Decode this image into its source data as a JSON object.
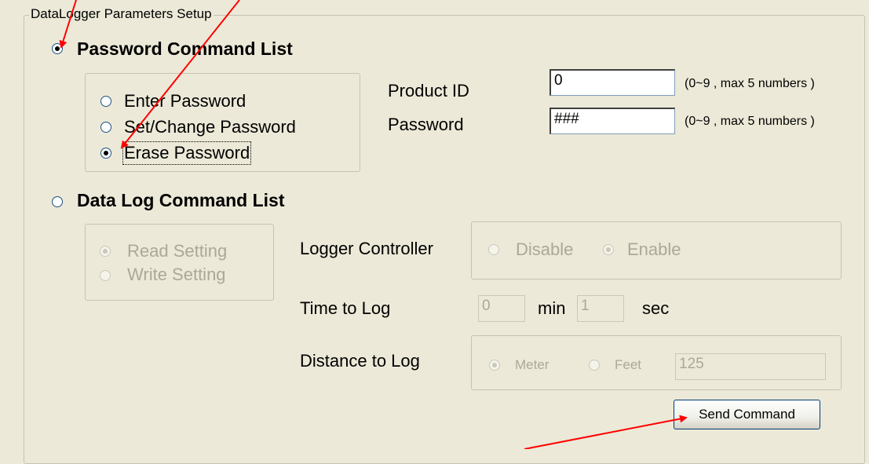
{
  "setup": {
    "title": "DataLogger Parameters Setup"
  },
  "password_section": {
    "heading": "Password Command List",
    "selected": true,
    "options": [
      {
        "label": "Enter Password",
        "checked": false
      },
      {
        "label": "Set/Change Password",
        "checked": false
      },
      {
        "label": "Erase Password",
        "checked": true
      }
    ],
    "product_id": {
      "label": "Product ID",
      "value": "0",
      "hint": "(0~9 , max 5 numbers )"
    },
    "password": {
      "label": "Password",
      "value": "###",
      "hint": "(0~9 , max 5 numbers )"
    }
  },
  "datalog_section": {
    "heading": "Data Log Command List",
    "selected": false,
    "options": [
      {
        "label": "Read Setting",
        "checked": true,
        "disabled": true
      },
      {
        "label": "Write Setting",
        "checked": false,
        "disabled": true
      }
    ],
    "logger_controller": {
      "label": "Logger Controller",
      "disable_label": "Disable",
      "enable_label": "Enable",
      "selected": "Enable"
    },
    "time_to_log": {
      "label": "Time to Log",
      "min_value": "0",
      "min_unit": "min",
      "sec_value": "1",
      "sec_unit": "sec"
    },
    "distance_to_log": {
      "label": "Distance to Log",
      "meter_label": "Meter",
      "feet_label": "Feet",
      "selected": "Meter",
      "value": "125"
    }
  },
  "send_button": {
    "label": "Send Command"
  },
  "colors": {
    "background": "#ece9d8",
    "annotation_arrow": "#ff0000",
    "disabled_text": "#aca899"
  }
}
